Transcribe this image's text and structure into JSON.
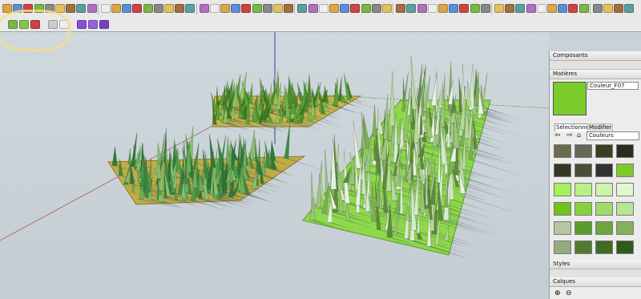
{
  "toolbar": {
    "top_icons": [
      "select-icon",
      "eraser-icon",
      "paint-bucket-icon",
      "line-icon",
      "rectangle-icon",
      "circle-icon",
      "arc-icon",
      "move-icon",
      "push-pull-icon",
      "rotate-icon",
      "follow-me-icon",
      "scale-icon",
      "offset-icon",
      "tape-measure-icon",
      "dimension-icon",
      "protractor-icon",
      "text-icon",
      "axes-icon",
      "3d-text-icon",
      "orbit-icon",
      "pan-icon",
      "zoom-icon",
      "zoom-extents-icon",
      "previous-view-icon",
      "next-view-icon",
      "iso-view-icon",
      "top-view-icon",
      "front-view-icon",
      "right-view-icon",
      "back-view-icon",
      "left-view-icon",
      "xray-icon",
      "wireframe-icon",
      "hidden-line-icon",
      "shaded-icon",
      "textured-icon",
      "monochrome-icon",
      "shadows-icon",
      "fog-icon",
      "section-plane-icon",
      "sandbox-icon",
      "smoove-icon",
      "stamp-icon",
      "drape-icon",
      "add-detail-icon",
      "flip-edge-icon",
      "position-camera-icon",
      "walk-icon",
      "look-around-icon",
      "geo-location-icon",
      "warehouse-icon",
      "share-model-icon",
      "extension-warehouse-icon",
      "layer-icon",
      "styles-icon",
      "components-icon",
      "materials-icon",
      "outliner-icon"
    ],
    "plugin_icons": [
      "grass-plugin-icon",
      "grass-variant-icon",
      "flower-plugin-icon",
      "grass-settings-icon",
      "brush-icon",
      "purple-cube-icon",
      "purple-cube-2-icon",
      "purple-cube-3-icon"
    ]
  },
  "panel": {
    "composants_title": "Composants",
    "matieres_title": "Matières",
    "material_name": "Couleur_F07",
    "material_color": "#7bcb2a",
    "tab_select": "Sélectionner",
    "tab_edit": "Modifier",
    "library": "Couleurs",
    "swatches": [
      "#6b6b4e",
      "#666758",
      "#3b3f22",
      "#2a2c1f",
      "#363826",
      "#4a4f3a",
      "#323231",
      "#7bcb2a",
      "#a6f05b",
      "#b8f088",
      "#cdf4a8",
      "#e3f8cf",
      "#6fc41a",
      "#86d23e",
      "#9edb68",
      "#b7e496",
      "#b4c7a0",
      "#5b9d28",
      "#6ea53e",
      "#85b15b",
      "#95aa7d",
      "#4f7a2f",
      "#3f6a22",
      "#2f5a1a"
    ],
    "styles_title": "Styles",
    "calques_title": "Calques",
    "add_layer": "⊕",
    "remove_layer": "⊖"
  }
}
